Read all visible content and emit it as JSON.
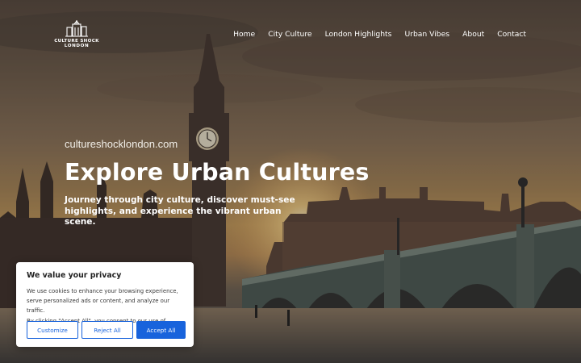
{
  "header": {
    "logo": {
      "line1": "CULTURE SHOCK",
      "line2": "LONDON"
    },
    "nav": [
      "Home",
      "City Culture",
      "London Highlights",
      "Urban Vibes",
      "About",
      "Contact"
    ]
  },
  "hero": {
    "site_url": "cultureshocklondon.com",
    "title": "Explore Urban Cultures",
    "subtitle": "Journey through city culture, discover must-see highlights, and experience the vibrant urban scene."
  },
  "cookie_banner": {
    "title": "We value your privacy",
    "text_lines": [
      "We use cookies to enhance your browsing experience,",
      "serve personalized ads or content, and analyze our traffic.",
      "By clicking \"Accept All\", you consent to our use of cookies."
    ],
    "buttons": {
      "customize": "Customize",
      "reject": "Reject All",
      "accept": "Accept All"
    }
  },
  "colors": {
    "accent": "#1863dc",
    "text_dark": "#212121",
    "white": "#ffffff"
  },
  "icons": {
    "logo": "city-skyline-icon"
  }
}
